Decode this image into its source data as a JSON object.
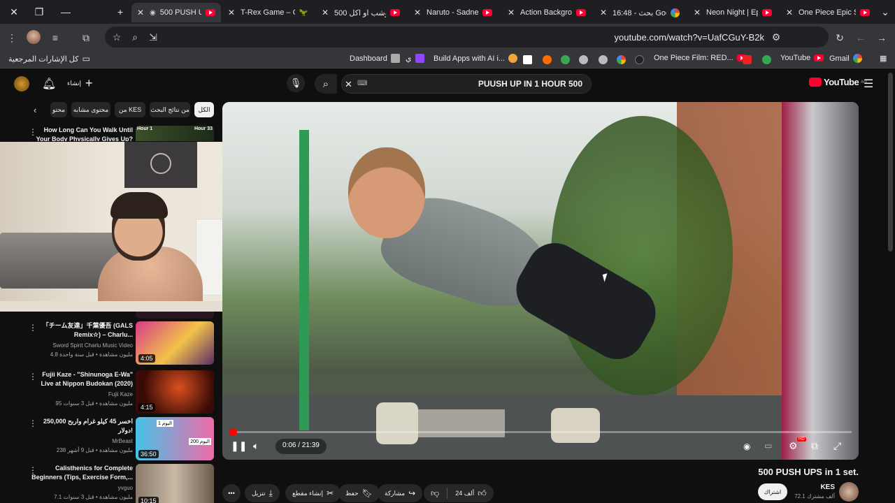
{
  "browser": {
    "tabs": [
      {
        "title": "500 PUSH U",
        "active": true,
        "icon": "youtube-icon"
      },
      {
        "title": "T-Rex Game – G",
        "icon": "dino-icon"
      },
      {
        "title": "500 بوشب او اكل",
        "icon": "youtube-icon"
      },
      {
        "title": "Naruto - Sadnes",
        "icon": "youtube-icon"
      },
      {
        "title": "Action Backgrou",
        "icon": "youtube-icon"
      },
      {
        "title": "16:48 - بحث Google",
        "icon": "google-icon"
      },
      {
        "title": "Neon Night | Epi",
        "icon": "youtube-icon"
      },
      {
        "title": "One Piece Epic S",
        "icon": "youtube-icon"
      }
    ],
    "url": "youtube.com/watch?v=UafCGuY-B2k",
    "bookmarks": {
      "all_label": "كل الإشارات المرجعية",
      "items": [
        "Dashboard",
        "ي",
        "Build Apps with AI i...",
        "One Piece Film: RED...",
        "YouTube",
        "Gmail"
      ]
    }
  },
  "youtube": {
    "logo_text": "YouTube",
    "logo_region": "AU",
    "create_label": "إنشاء",
    "search_query": "PUUSH UP  IN 1 HOUR 500",
    "chips": [
      "الكل",
      "من نتائج البحث",
      "من KES",
      "محتوى مشابه",
      "محتو"
    ],
    "recommendations": [
      {
        "title": "How Long Can You Walk Until Your Body Physically Gives Up?",
        "channel": "",
        "meta": "",
        "duration": "",
        "thumb_labels": [
          "Hour 1",
          "Hour 33"
        ]
      },
      {
        "title": "「チーム友達」千葉優吾 (GALS Remix☆) – Charlu...",
        "channel": "Sword Spirit Charlu Music Video",
        "meta": "4.8 مليون مشاهدة • قبل سنة واحدة",
        "duration": "4:05"
      },
      {
        "title": "Fujii Kaze - \"Shinunoga E-Wa\" Live at Nippon Budokan (2020)",
        "channel": "Fujii Kaze",
        "meta": "95 مليون مشاهدة • قبل 3 سنوات",
        "duration": "4:15"
      },
      {
        "title": "اخسر 45 كيلو غرام واربح 250,000 دولار!",
        "channel": "MrBeast",
        "meta": "238 مليون مشاهدة • قبل 9 أشهر",
        "duration": "36:50",
        "thumb_labels": [
          "اليوم 1",
          "اليوم 200"
        ]
      },
      {
        "title": "Calisthenics for Complete Beginners (Tips, Exercise Form,...",
        "channel": "yvguo",
        "meta": "7.1 مليون مشاهدة • قبل 3 سنوات",
        "duration": "10:15"
      }
    ],
    "player": {
      "time": "0:06 / 21:39",
      "progress": 0.005,
      "hd_badge": "HD"
    },
    "video": {
      "title": "500 PUSH UPS in 1 set.",
      "channel": "KES",
      "subscribers": "72.1 ألف مشترك",
      "subscribe_label": "اشتراك",
      "likes": "24 ألف",
      "share_label": "مشاركة",
      "save_label": "حفظ",
      "clip_label": "إنشاء مقطع",
      "download_label": "تنزيل"
    }
  }
}
